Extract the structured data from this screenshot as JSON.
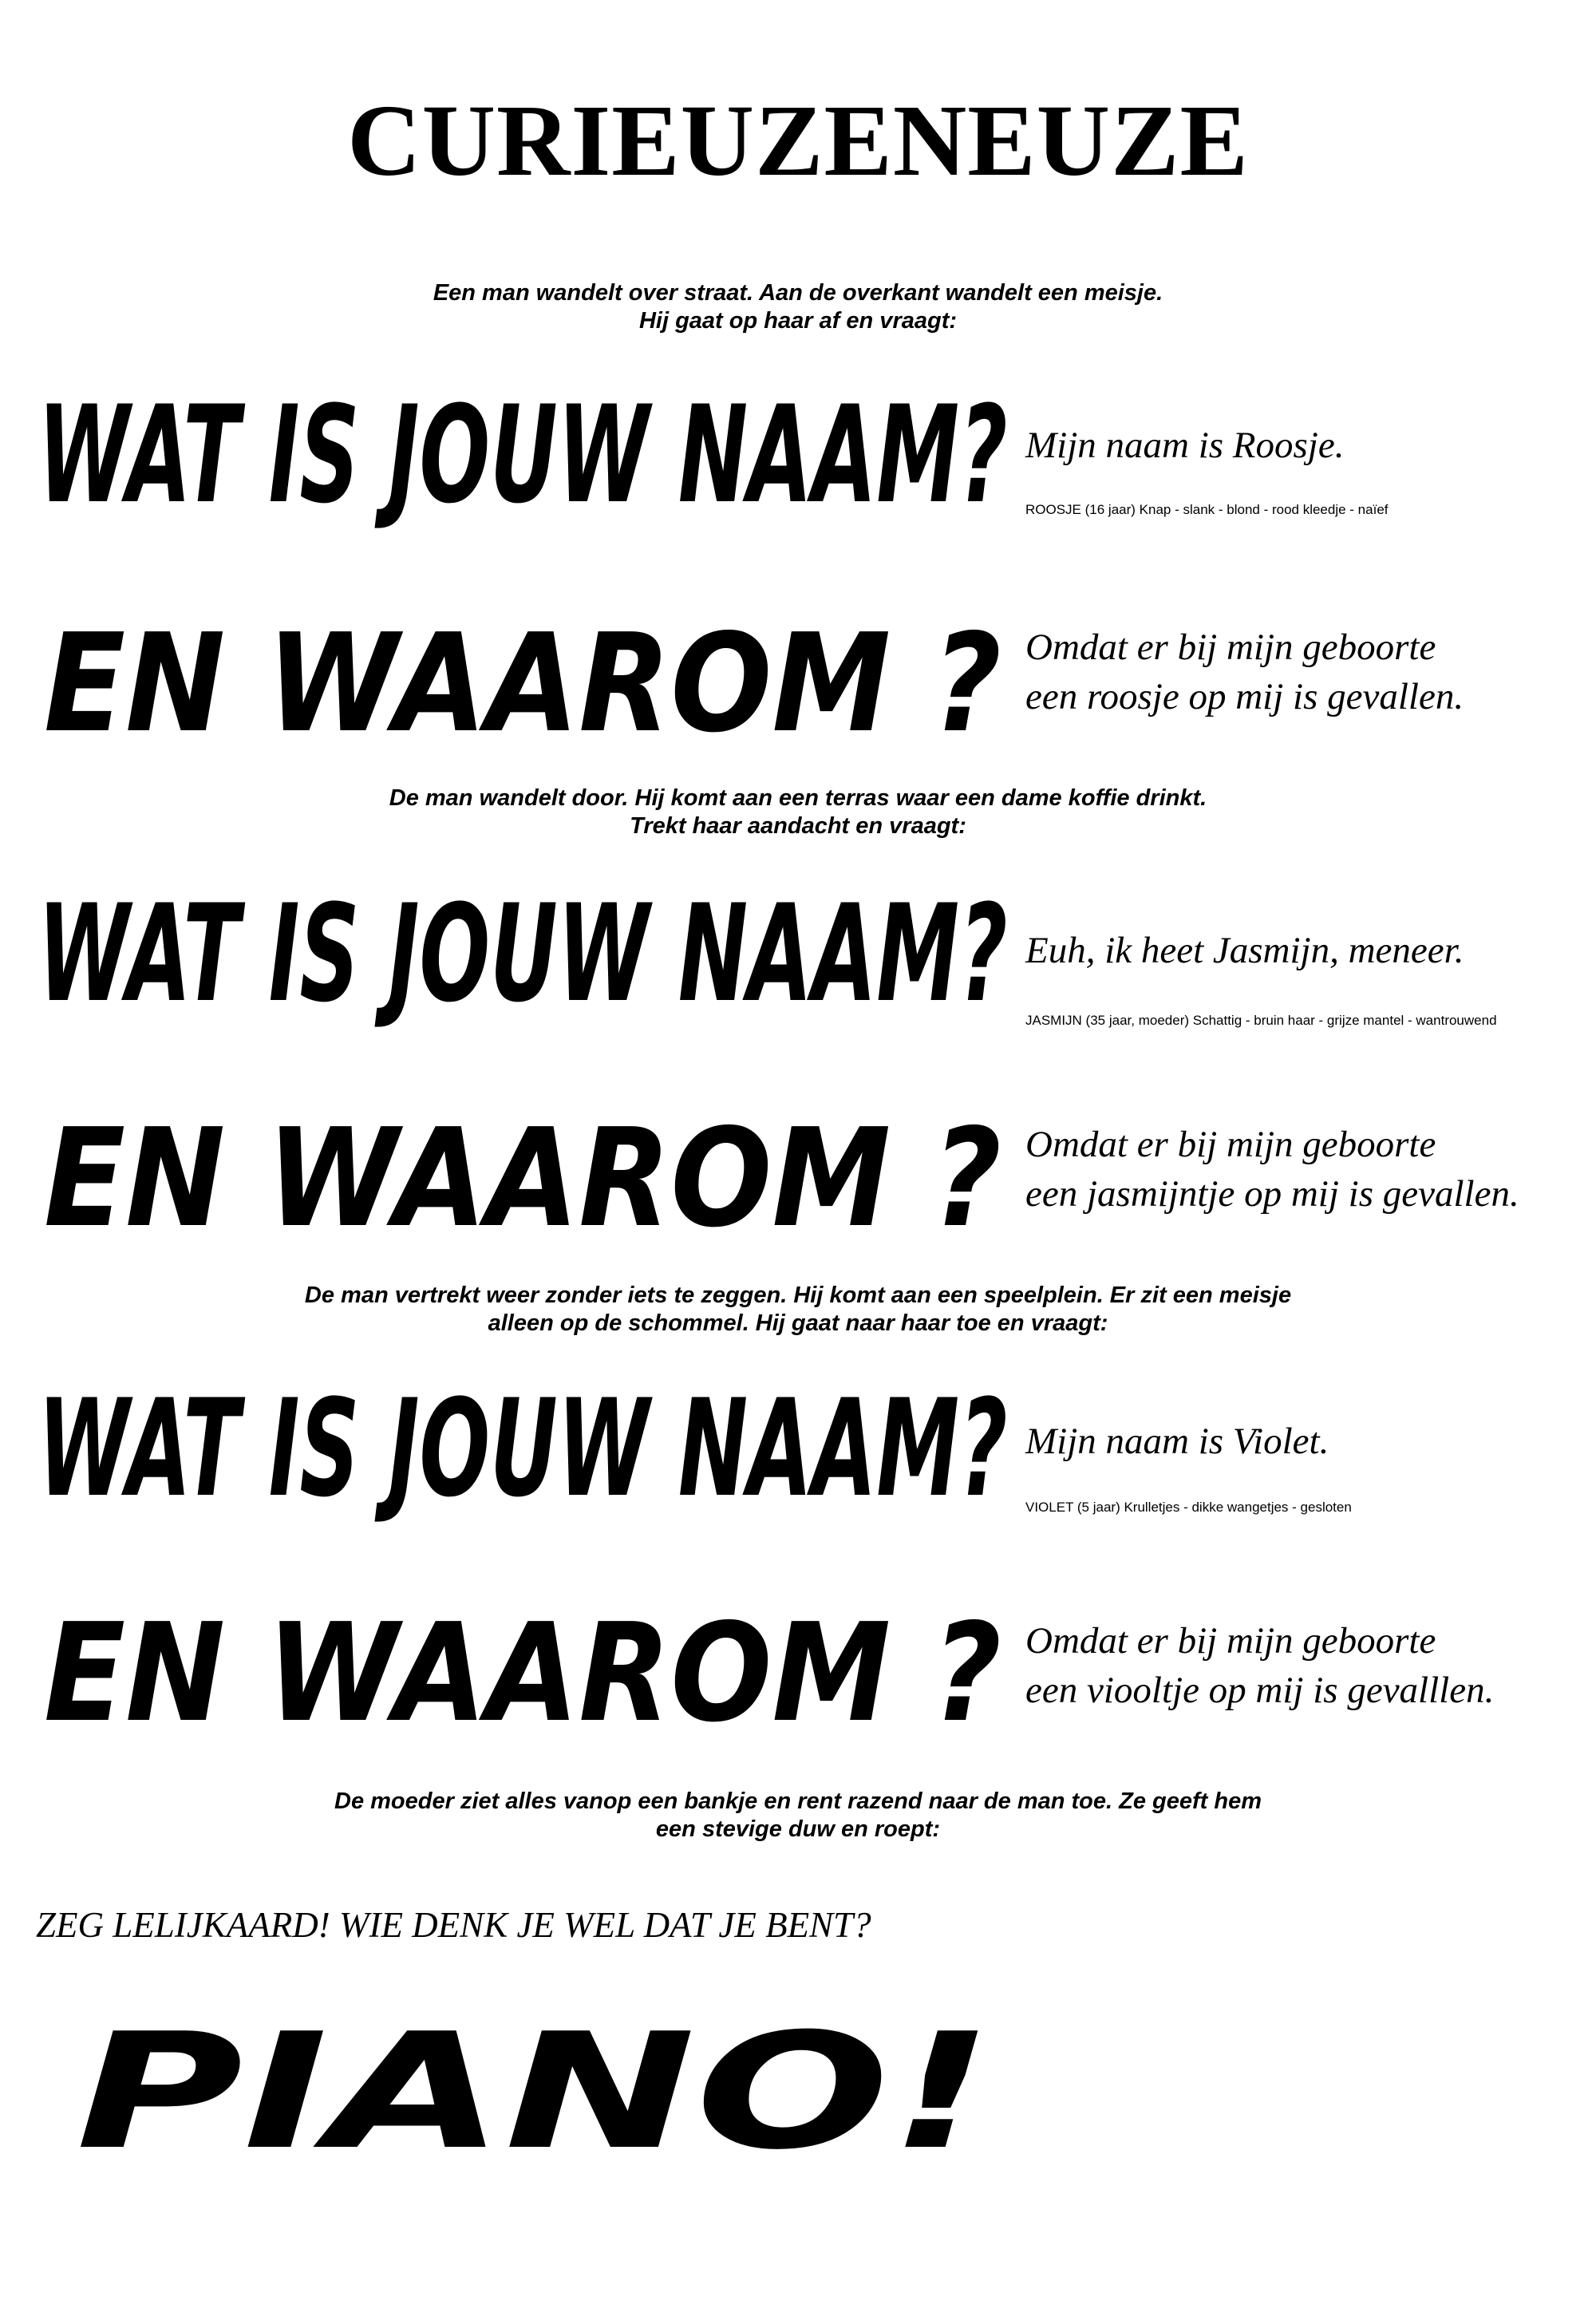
{
  "title": "CURIEUZENEUZE",
  "narration": {
    "n1": [
      "Een man wandelt over straat. Aan de overkant wandelt een meisje.",
      "Hij gaat op haar af en vraagt:"
    ],
    "n2": [
      "De man wandelt door. Hij komt aan een terras waar een dame koffie drinkt.",
      "Trekt haar aandacht en vraagt:"
    ],
    "n3": [
      "De man vertrekt weer zonder iets te zeggen. Hij komt aan een speelplein. Er zit een meisje",
      "alleen op de schommel. Hij gaat naar haar toe en vraagt:"
    ],
    "n4": [
      "De moeder ziet alles vanop een bankje en rent razend naar de man toe. Ze geeft hem",
      "een stevige duw en roept:"
    ]
  },
  "question_name": "WAT IS JOUW NAAM?",
  "question_why": "EN WAAROM ?",
  "answers": {
    "roosje_name": "Mijn naam is Roosje.",
    "roosje_desc": "ROOSJE (16 jaar) Knap - slank - blond - rood kleedje - naïef",
    "roosje_why": [
      "Omdat er bij mijn geboorte",
      "een roosje op mij is gevallen."
    ],
    "jasmijn_name": "Euh, ik heet Jasmijn, meneer.",
    "jasmijn_desc": "JASMIJN (35 jaar, moeder) Schattig - bruin haar - grijze mantel - wantrouwend",
    "jasmijn_why": [
      "Omdat er bij mijn geboorte",
      "een jasmijntje op mij is gevallen."
    ],
    "violet_name": "Mijn naam is Violet.",
    "violet_desc": "VIOLET (5 jaar) Krulletjes - dikke wangetjes -  gesloten",
    "violet_why": [
      "Omdat er bij mijn geboorte",
      "een viooltje op mij is gevalllen."
    ]
  },
  "shout": "ZEG LELIJKAARD! WIE DENK JE WEL DAT JE BENT?",
  "final": "PIANO!"
}
